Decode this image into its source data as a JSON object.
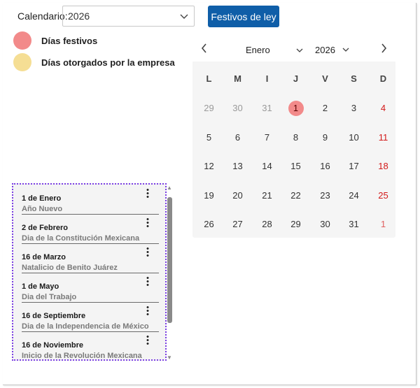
{
  "topbar": {
    "calendar_label": "Calendario:",
    "year_value": "2026",
    "holidays_button": "Festivos de ley"
  },
  "legend": [
    {
      "label": "Días festivos",
      "color": "#f28a8a"
    },
    {
      "label": "Días otorgados por la empresa",
      "color": "#f5de94"
    }
  ],
  "calendar": {
    "month": "Enero",
    "year": "2026",
    "weekday_headers": [
      "L",
      "M",
      "I",
      "J",
      "V",
      "S",
      "D"
    ],
    "weeks": [
      [
        "29",
        "30",
        "31",
        "1",
        "2",
        "3",
        "4"
      ],
      [
        "5",
        "6",
        "7",
        "8",
        "9",
        "10",
        "11"
      ],
      [
        "12",
        "13",
        "14",
        "15",
        "16",
        "17",
        "18"
      ],
      [
        "19",
        "20",
        "21",
        "22",
        "23",
        "24",
        "25"
      ],
      [
        "26",
        "27",
        "28",
        "29",
        "30",
        "31",
        "1"
      ]
    ]
  },
  "holidays": [
    {
      "date": "1 de Enero",
      "name": "Año Nuevo"
    },
    {
      "date": "2 de Febrero",
      "name": "Dia de la Constitución Mexicana"
    },
    {
      "date": "16 de Marzo",
      "name": "Natalicio de Benito Juárez"
    },
    {
      "date": "1 de Mayo",
      "name": "Dia del Trabajo"
    },
    {
      "date": "16 de Septiembre",
      "name": "Dia de la Independencia de México"
    },
    {
      "date": "16 de Noviembre",
      "name": "Inicio de la Revolución Mexicana"
    }
  ],
  "icons": {
    "prev": "chevron-left-icon",
    "next": "chevron-right-icon",
    "dropdown": "chevron-down-icon",
    "more": "more-vertical-icon"
  },
  "colors": {
    "accent": "#0f5ea8",
    "holiday": "#f28a8a",
    "company_day": "#f5de94",
    "sunday": "#d21a1a",
    "selection_border": "#7b3fe4"
  }
}
